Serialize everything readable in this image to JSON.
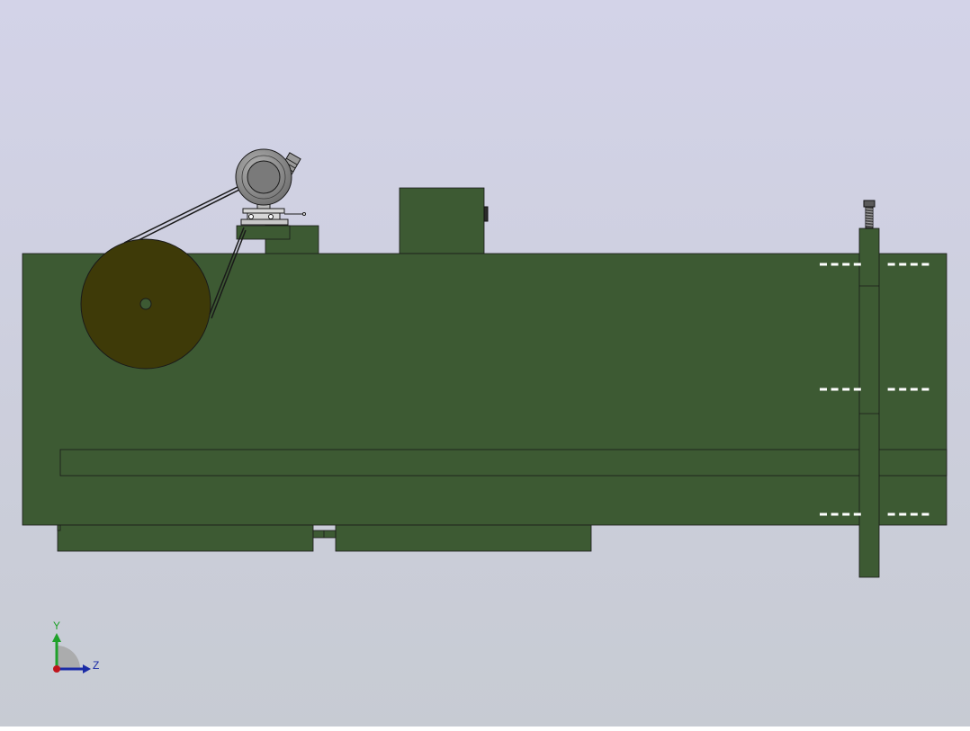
{
  "viewport": {
    "background_top": "#d3d3e8",
    "background_bottom": "#c7cbd3"
  },
  "model": {
    "body_color": "#3d5a33",
    "edge_color": "#1a1a1a",
    "pulley_color": "#3e3a08",
    "motor_color": "#8a8a8a",
    "motor_inner_color": "#7a7a7a",
    "slot_color": "#ffffff"
  },
  "triad": {
    "y_label": "Y",
    "z_label": "Z",
    "y_color": "#1fa12a",
    "z_color": "#1a2ba6",
    "x_color": "#c0141c"
  }
}
